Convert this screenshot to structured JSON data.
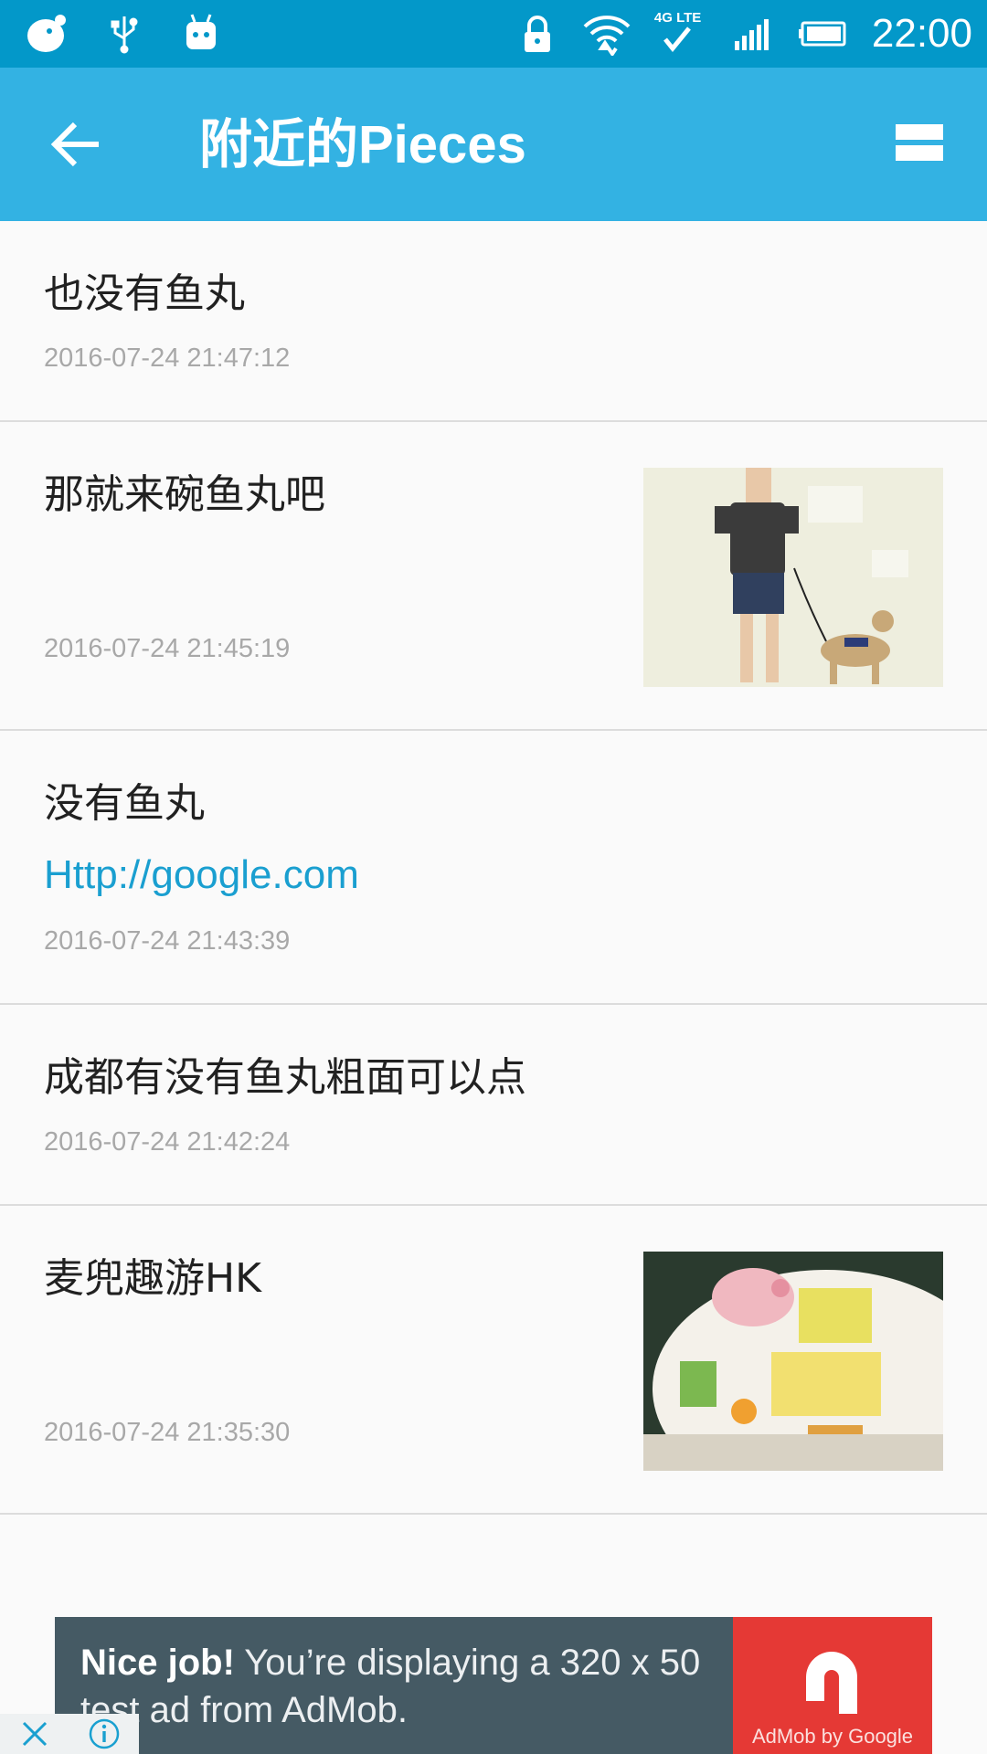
{
  "status_bar": {
    "time": "22:00",
    "network_label": "4G LTE",
    "left_icons": [
      "chat-bubble-icon",
      "usb-icon",
      "android-icon"
    ],
    "right_icons": [
      "lock-icon",
      "wifi-icon",
      "lte-icon",
      "signal-icon",
      "battery-icon"
    ]
  },
  "app_bar": {
    "title": "附近的Pieces",
    "back_icon": "arrow-left-icon",
    "view_icon": "view-list-icon",
    "background": "#33b2e3"
  },
  "items": [
    {
      "text": "也没有鱼丸",
      "time": "2016-07-24 21:47:12"
    },
    {
      "text": "那就来碗鱼丸吧",
      "time": "2016-07-24 21:45:19",
      "image": "photo-person-with-dog"
    },
    {
      "text": "没有鱼丸",
      "link": "Http://google.com",
      "time": "2016-07-24 21:43:39"
    },
    {
      "text": "成都有没有鱼丸粗面可以点",
      "time": "2016-07-24 21:42:24"
    },
    {
      "text": "麦兜趣游HK",
      "time": "2016-07-24 21:35:30",
      "image": "photo-mcdull-mug"
    }
  ],
  "ad": {
    "headline": "Nice job!",
    "body": "You’re displaying a 320 x 50 test ad from AdMob.",
    "brand": "AdMob by Google",
    "close_icon": "close-icon",
    "info_icon": "info-icon"
  }
}
